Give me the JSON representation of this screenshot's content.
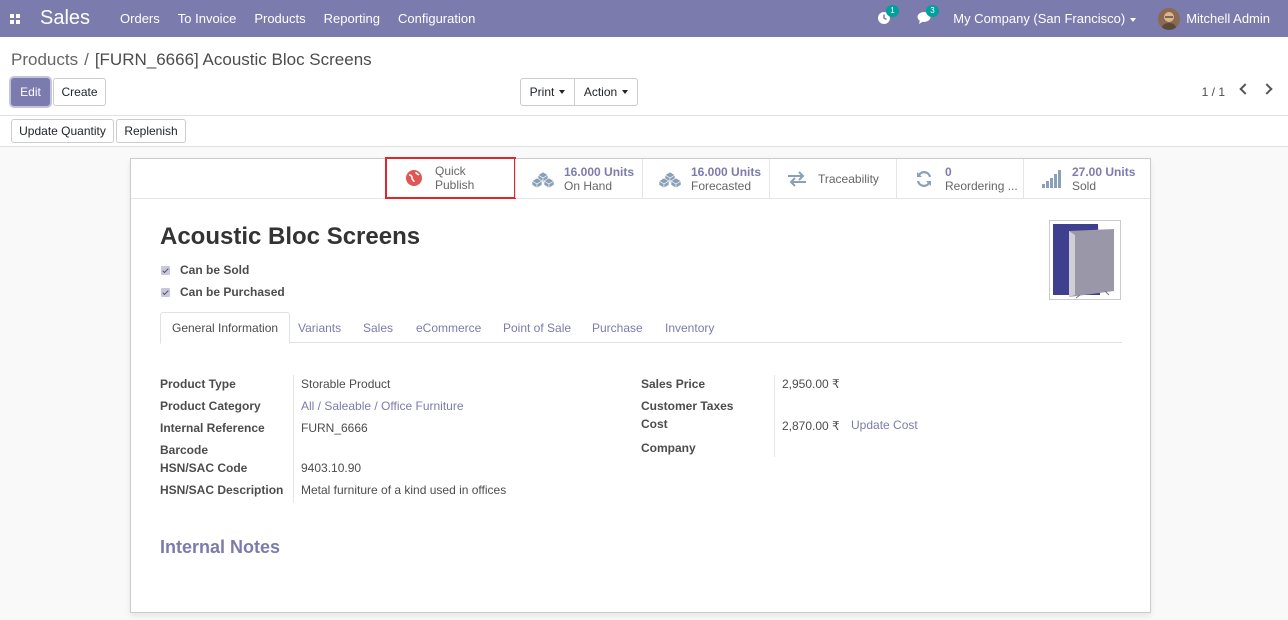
{
  "navbar": {
    "app_name": "Sales",
    "menu": [
      "Orders",
      "To Invoice",
      "Products",
      "Reporting",
      "Configuration"
    ],
    "activity_count": "1",
    "message_count": "3",
    "company": "My Company (San Francisco)",
    "user": "Mitchell Admin",
    "accent": "#7c7bad"
  },
  "breadcrumb": {
    "parent": "Products",
    "separator": "/",
    "current": "[FURN_6666] Acoustic Bloc Screens"
  },
  "toolbar": {
    "edit": "Edit",
    "create": "Create",
    "print": "Print",
    "action": "Action",
    "pager": "1 / 1"
  },
  "status_buttons": {
    "update_quantity": "Update Quantity",
    "replenish": "Replenish"
  },
  "smart_buttons": [
    {
      "value": "Quick",
      "label": "Publish",
      "icon": "globe-icon"
    },
    {
      "value": "16.000 Units",
      "label": "On Hand",
      "icon": "cubes-icon"
    },
    {
      "value": "16.000 Units",
      "label": "Forecasted",
      "icon": "cubes-icon"
    },
    {
      "value": "",
      "label": "Traceability",
      "icon": "exchange-arrows-icon"
    },
    {
      "value": "0",
      "label": "Reordering ...",
      "icon": "refresh-icon"
    },
    {
      "value": "27.00 Units",
      "label": "Sold",
      "icon": "signal-bars-icon"
    }
  ],
  "product": {
    "name": "Acoustic Bloc Screens",
    "can_be_sold": "Can be Sold",
    "can_be_purchased": "Can be Purchased"
  },
  "tabs": [
    "General Information",
    "Variants",
    "Sales",
    "eCommerce",
    "Point of Sale",
    "Purchase",
    "Inventory"
  ],
  "fields_left": [
    {
      "label": "Product Type",
      "value": "Storable Product"
    },
    {
      "label": "Product Category",
      "value": "All / Saleable / Office Furniture"
    },
    {
      "label": "Internal Reference",
      "value": "FURN_6666"
    },
    {
      "label": "Barcode",
      "value": ""
    },
    {
      "label": "HSN/SAC Code",
      "value": "9403.10.90"
    },
    {
      "label": "HSN/SAC Description",
      "value": "Metal furniture of a kind used in offices"
    }
  ],
  "fields_right": [
    {
      "label": "Sales Price",
      "value": "2,950.00 ₹"
    },
    {
      "label": "Customer Taxes",
      "value": ""
    },
    {
      "label": "Cost",
      "value": "2,870.00 ₹",
      "action": "Update Cost"
    },
    {
      "label": "Company",
      "value": ""
    }
  ],
  "internal_notes": "Internal Notes"
}
